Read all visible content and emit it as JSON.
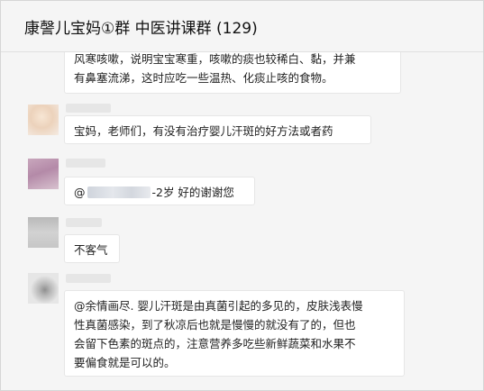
{
  "header": {
    "title": "康謦儿宝妈①群 中医讲课群 (129)"
  },
  "messages": [
    {
      "lines": [
        "风寒咳嗽，说明宝宝寒重，咳嗽的痰也较稀白、黏，并兼",
        "有鼻塞流涕，这时应吃一些温热、化痰止咳的食物。"
      ]
    },
    {
      "text": "宝妈，老师们，有没有治疗婴儿汗斑的好方法或者药"
    },
    {
      "prefix": "@",
      "suffix": "-2岁 好的谢谢您"
    },
    {
      "text": "不客气"
    },
    {
      "lines": [
        "@余情画尽. 婴儿汗斑是由真菌引起的多见的，皮肤浅表慢",
        "性真菌感染，到了秋凉后也就是慢慢的就没有了的，但也",
        "会留下色素的斑点的，注意营养多吃些新鲜蔬菜和水果不",
        "要偏食就是可以的。"
      ]
    }
  ],
  "colors": {
    "background": "#f5f5f5",
    "bubble": "#ffffff",
    "text": "#222222"
  }
}
